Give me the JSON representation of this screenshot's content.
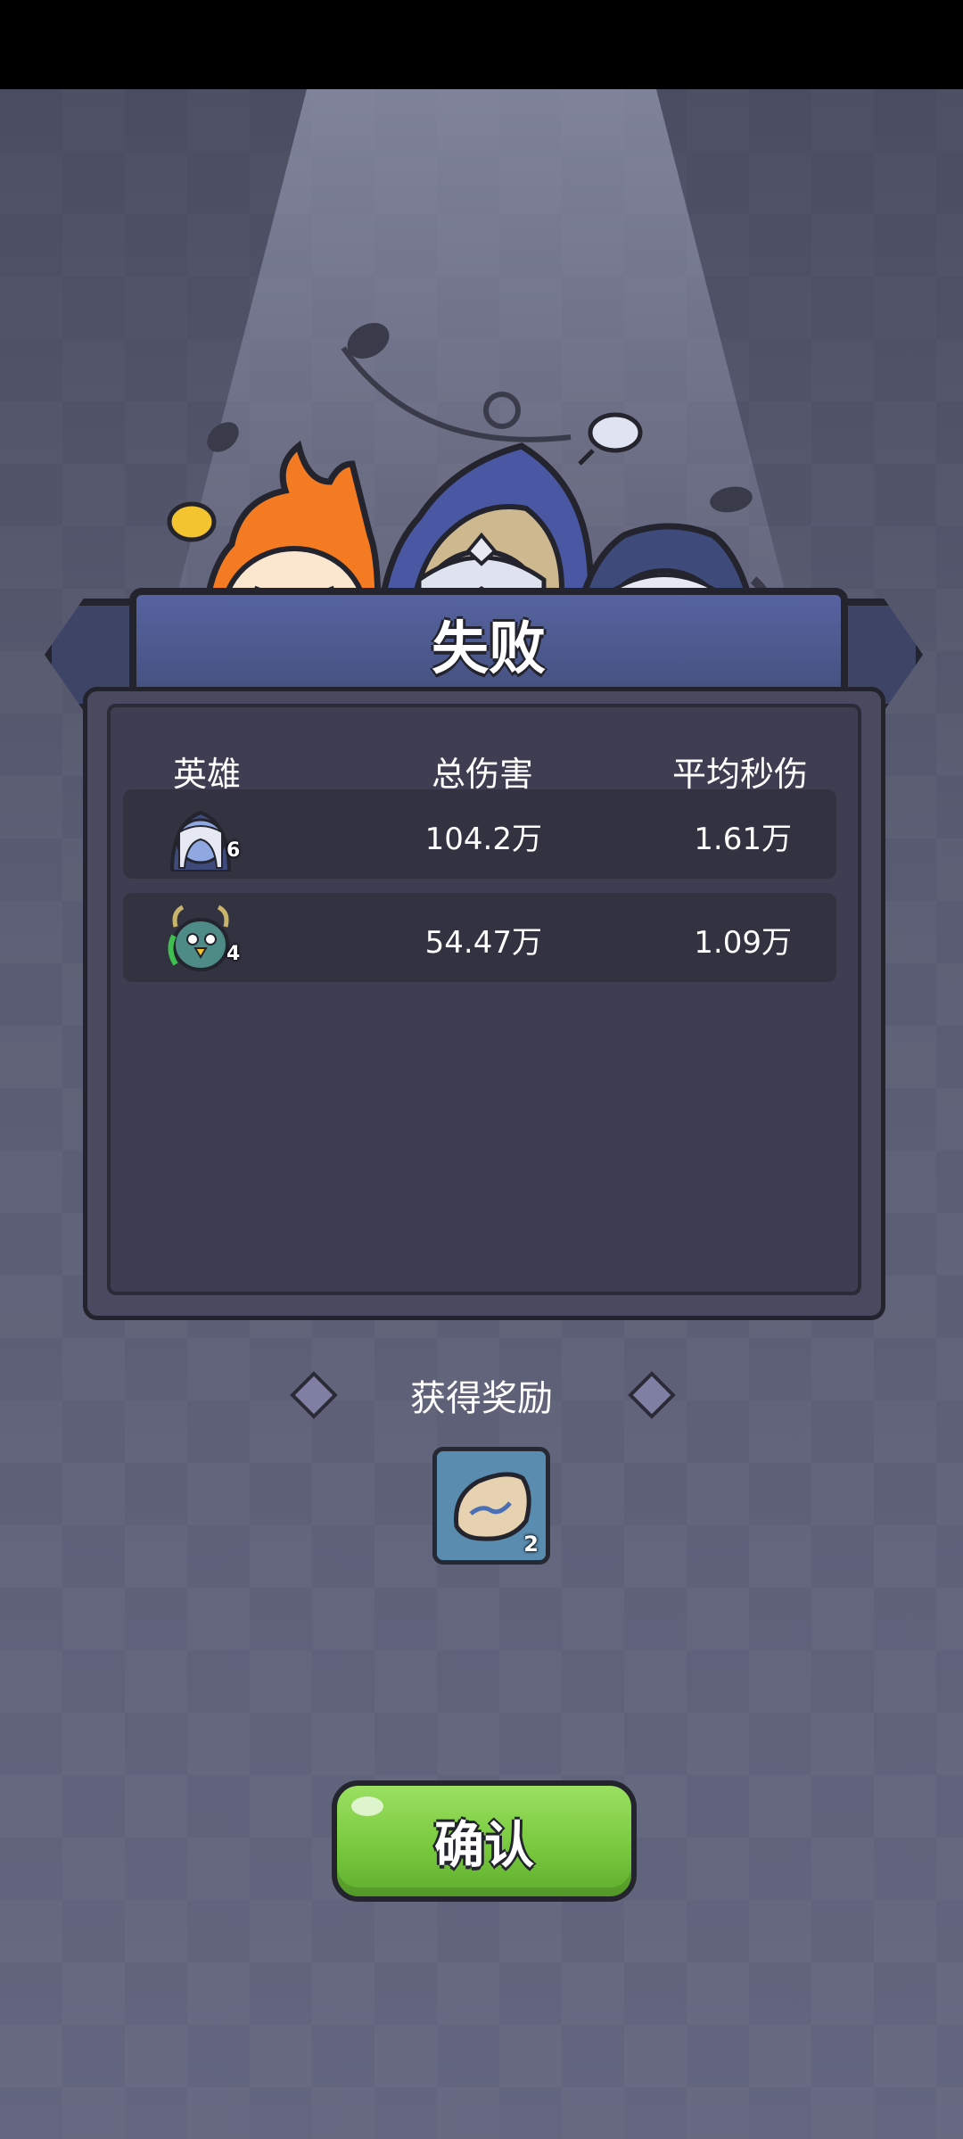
{
  "result": {
    "title": "失败"
  },
  "table": {
    "headers": [
      "英雄",
      "总伤害",
      "平均秒伤"
    ],
    "rows": [
      {
        "hero_icon": "blue-elf-hero-icon",
        "level": "6",
        "total_damage": "104.2万",
        "avg_dps": "1.61万"
      },
      {
        "hero_icon": "antlered-bird-hero-icon",
        "level": "4",
        "total_damage": "54.47万",
        "avg_dps": "1.09万"
      }
    ]
  },
  "rewards": {
    "title": "获得奖励",
    "items": [
      {
        "icon": "rune-stone-icon",
        "count": "2"
      }
    ]
  },
  "confirm": {
    "label": "确认"
  },
  "colors": {
    "banner": "#4f5a91",
    "panel": "#3f3d52",
    "confirm": "#7ccb45",
    "background": "#5c5e76"
  }
}
